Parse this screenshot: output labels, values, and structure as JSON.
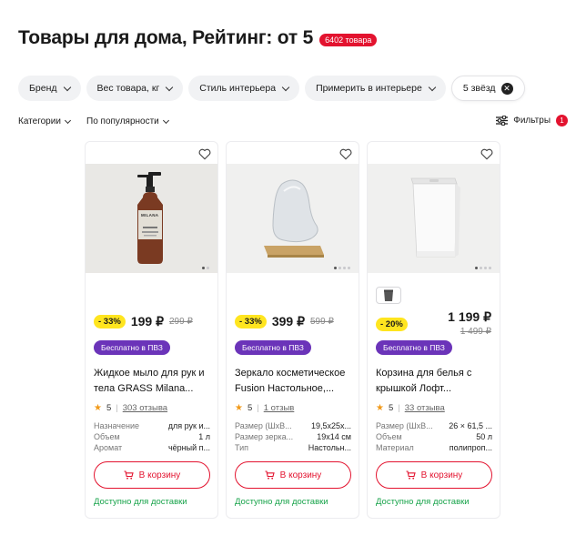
{
  "header": {
    "title": "Товары для дома, Рейтинг: от 5",
    "count_badge": "6402 товара"
  },
  "chips": [
    {
      "label": "Бренд"
    },
    {
      "label": "Вес товара, кг"
    },
    {
      "label": "Стиль интерьера"
    },
    {
      "label": "Примерить в интерьере"
    },
    {
      "label": "5 звёзд",
      "clear_icon": "close-icon"
    }
  ],
  "sortbar": {
    "categories": "Категории",
    "sort": "По популярности",
    "filters": "Фильтры",
    "filters_count": "1"
  },
  "products": [
    {
      "discount": "- 33%",
      "price": "199 ₽",
      "old_price": "299 ₽",
      "badge": "Бесплатно в ПВЗ",
      "name_line1": "Жидкое мыло для рук и",
      "name_line2": "тела GRASS Milana...",
      "rating": "5",
      "reviews": "303 отзыва",
      "attrs": [
        {
          "k": "Назначение",
          "v": "для рук и..."
        },
        {
          "k": "Объем",
          "v": "1 л"
        },
        {
          "k": "Аромат",
          "v": "чёрный п..."
        }
      ],
      "cart": "В корзину",
      "availability": "Доступно для доставки",
      "bottle_label": "MILANA"
    },
    {
      "discount": "- 33%",
      "price": "399 ₽",
      "old_price": "599 ₽",
      "badge": "Бесплатно в ПВЗ",
      "name_line1": "Зеркало косметическое",
      "name_line2": "Fusion Настольное,...",
      "rating": "5",
      "reviews": "1 отзыв",
      "attrs": [
        {
          "k": "Размер (ШхВ...",
          "v": "19,5х25х..."
        },
        {
          "k": "Размер зерка...",
          "v": "19х14 см"
        },
        {
          "k": "Тип",
          "v": "Настольн..."
        }
      ],
      "cart": "В корзину",
      "availability": "Доступно для доставки"
    },
    {
      "discount": "- 20%",
      "price": "1 199 ₽",
      "old_price": "1 499 ₽",
      "badge": "Бесплатно в ПВЗ",
      "name_line1": "Корзина для белья с",
      "name_line2": "крышкой Лофт...",
      "rating": "5",
      "reviews": "33 отзыва",
      "attrs": [
        {
          "k": "Размер (ШхВ...",
          "v": "26 × 61,5 ..."
        },
        {
          "k": "Объем",
          "v": "50 л"
        },
        {
          "k": "Материал",
          "v": "полипроп..."
        }
      ],
      "cart": "В корзину",
      "availability": "Доступно для доставки"
    }
  ],
  "colors": {
    "accent": "#e3132f",
    "discount": "#ffe51f",
    "badge": "#6b34b9",
    "available": "#17a34a"
  }
}
